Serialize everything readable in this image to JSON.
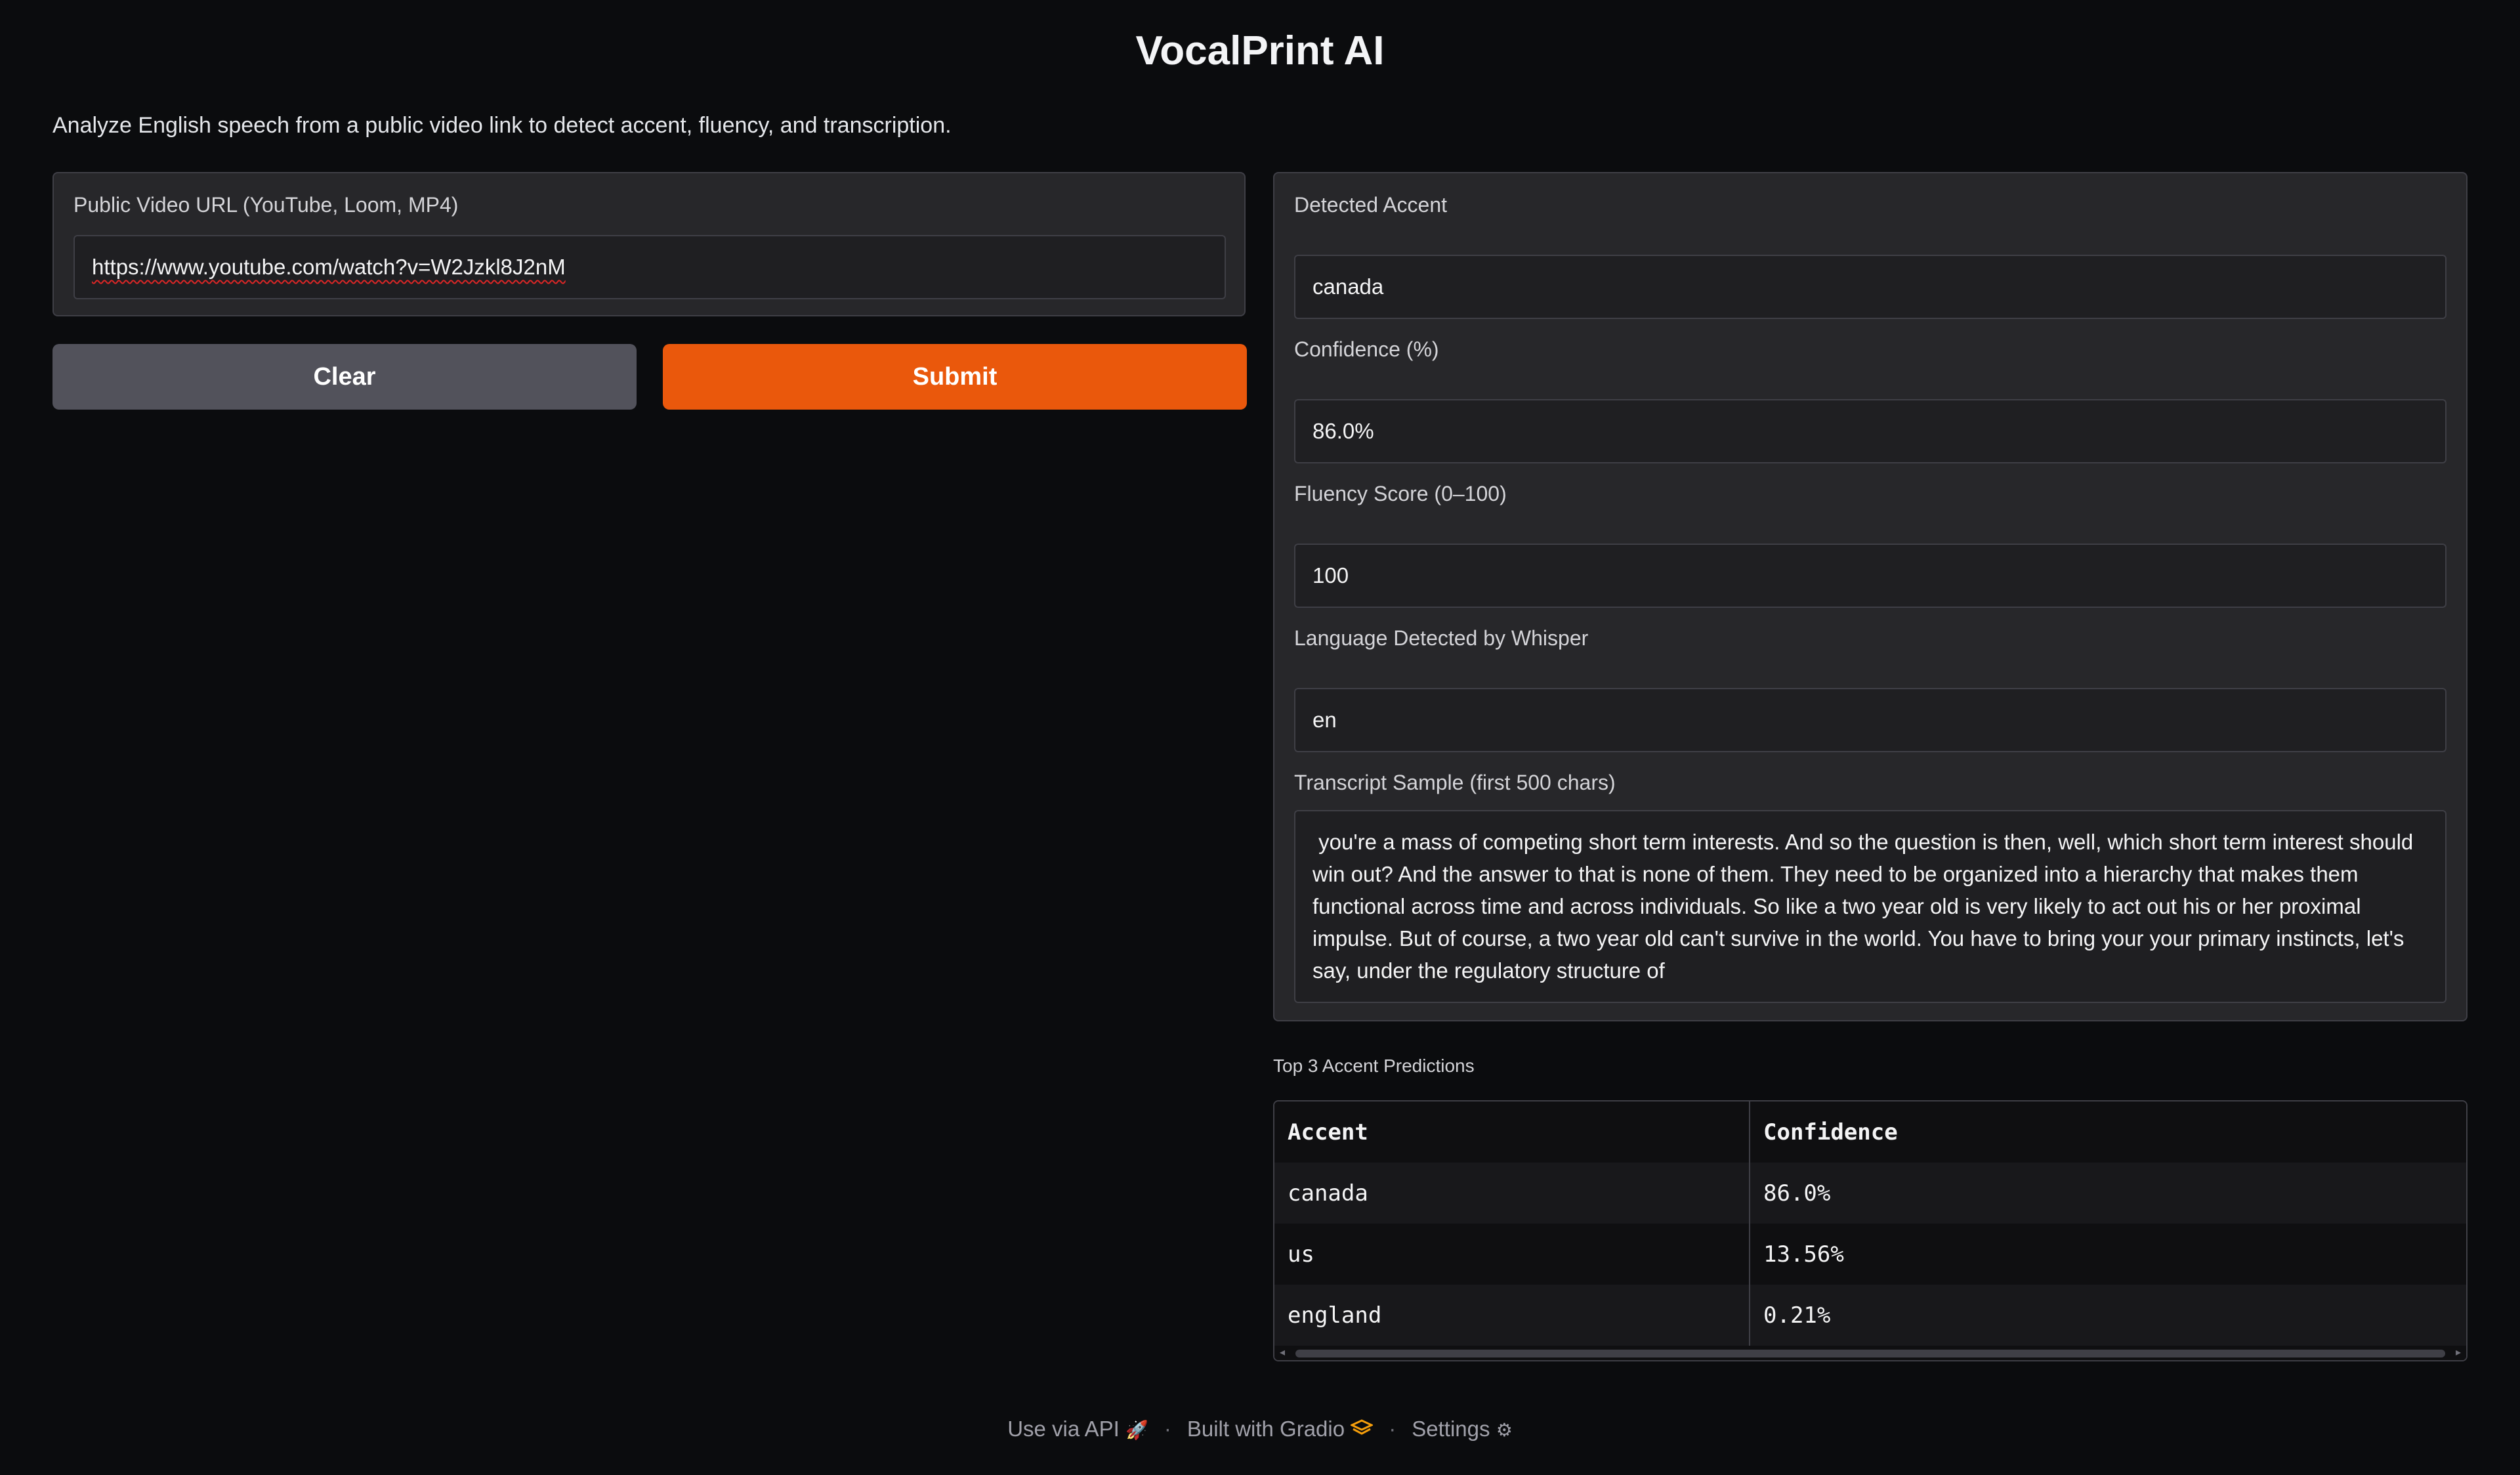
{
  "app": {
    "title": "VocalPrint AI",
    "description": "Analyze English speech from a public video link to detect accent, fluency, and transcription."
  },
  "input": {
    "label": "Public Video URL (YouTube, Loom, MP4)",
    "value": "https://www.youtube.com/watch?v=W2Jzkl8J2nM"
  },
  "buttons": {
    "clear": "Clear",
    "submit": "Submit"
  },
  "results": {
    "accent_label": "Detected Accent",
    "accent_value": "canada",
    "confidence_label": "Confidence (%)",
    "confidence_value": "86.0%",
    "fluency_label": "Fluency Score (0–100)",
    "fluency_value": "100",
    "language_label": "Language Detected by Whisper",
    "language_value": "en",
    "transcript_label": "Transcript Sample (first 500 chars)",
    "transcript_value": " you're a mass of competing short term interests. And so the question is then, well, which short term interest should win out? And the answer to that is none of them. They need to be organized into a hierarchy that makes them functional across time and across individuals. So like a two year old is very likely to act out his or her proximal impulse. But of course, a two year old can't survive in the world. You have to bring your your primary instincts, let's say, under the regulatory structure of"
  },
  "predictions": {
    "label": "Top 3 Accent Predictions",
    "headers": [
      "Accent",
      "Confidence"
    ],
    "rows": [
      [
        "canada",
        "86.0%"
      ],
      [
        "us",
        "13.56%"
      ],
      [
        "england",
        "0.21%"
      ]
    ]
  },
  "footer": {
    "api": "Use via API",
    "built": "Built with Gradio",
    "settings": "Settings",
    "separator": "·",
    "icons": [
      "rocket-icon",
      "gradio-logo-icon",
      "gear-icon"
    ]
  },
  "colors": {
    "accent": "#ea580c",
    "background": "#0b0c0e",
    "panel": "#27272a"
  }
}
